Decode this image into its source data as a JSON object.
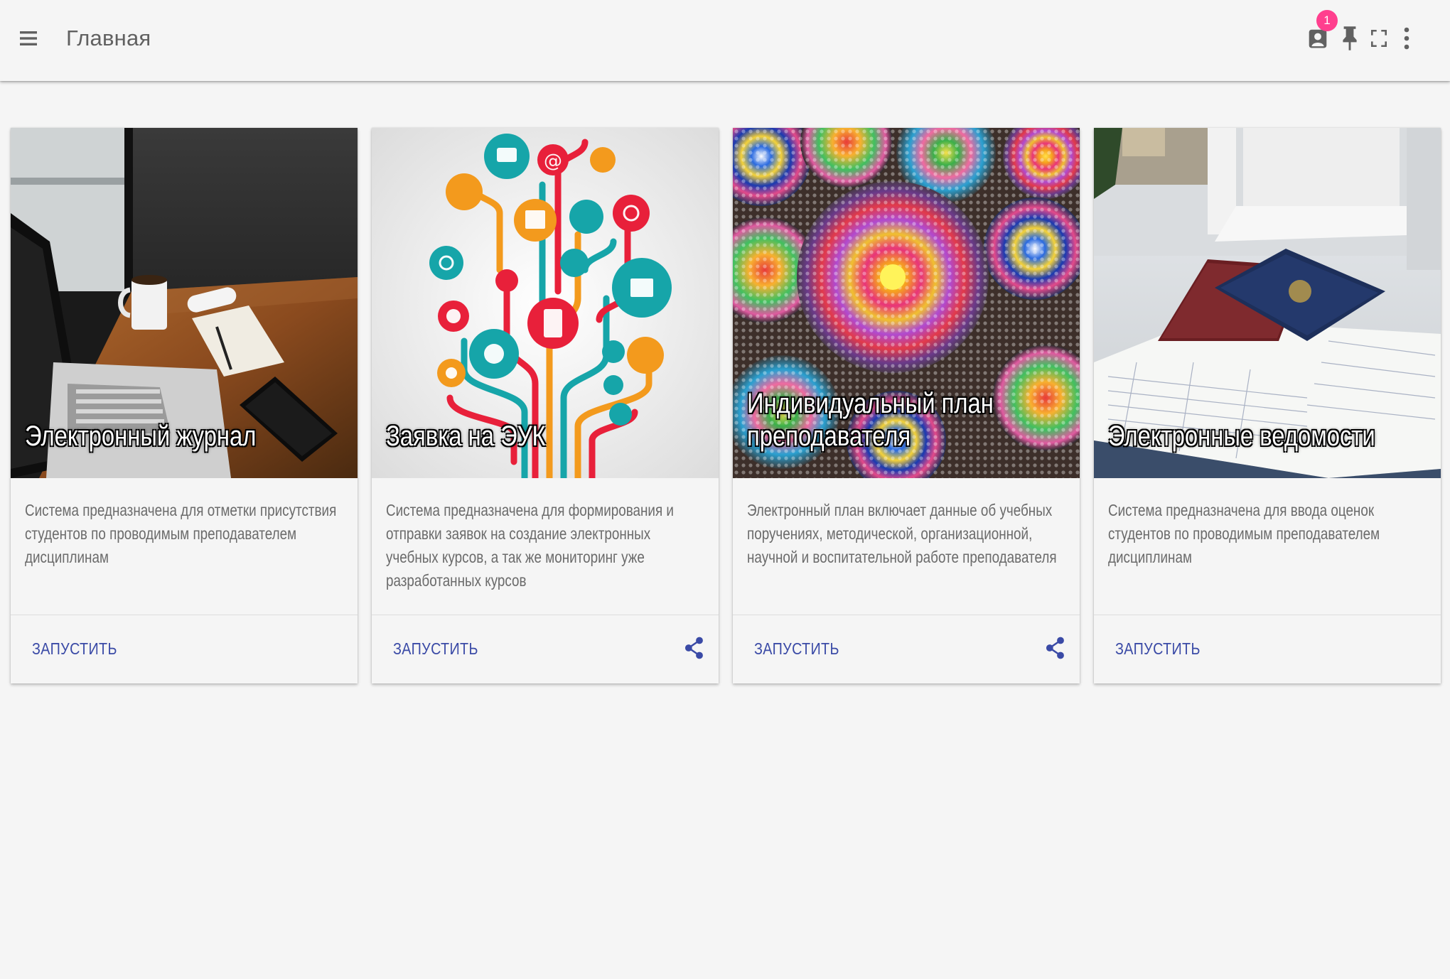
{
  "appbar": {
    "title": "Главная",
    "menu_icon": "menu-icon",
    "notifications_count": "1",
    "icons": [
      "account-box-icon",
      "pin-icon",
      "fullscreen-icon",
      "more-vert-icon"
    ]
  },
  "colors": {
    "background": "#f5f5f5",
    "action": "#3a4aa6",
    "badge": "#ff3f8e"
  },
  "cards": [
    {
      "title": "Электронный журнал",
      "description": "Система предназначена для отметки присутствия студентов по проводимым преподавателем дисциплинам",
      "action_label": "ЗАПУСТИТЬ",
      "has_share": false,
      "image": "laptop-desk-photo"
    },
    {
      "title": "Заявка на ЭУК",
      "description": "Система предназначена для формирования и отправки заявок на создание электронных учебных курсов, а так же мониторинг уже разработанных курсов",
      "action_label": "ЗАПУСТИТЬ",
      "has_share": true,
      "image": "education-tree-illustration"
    },
    {
      "title": "Индивидуальный план преподавателя",
      "description": "Электронный план включает данные об учебных поручениях, методической, организационной, научной и воспитательной работе преподавателя",
      "action_label": "ЗАПУСТИТЬ",
      "has_share": true,
      "image": "dot-mandala-stones-photo"
    },
    {
      "title": "Электронные ведомости",
      "description": "Система предназначена для ввода оценок студентов по проводимым преподавателем дисциплинам",
      "action_label": "ЗАПУСТИТЬ",
      "has_share": false,
      "image": "record-books-photo"
    }
  ]
}
